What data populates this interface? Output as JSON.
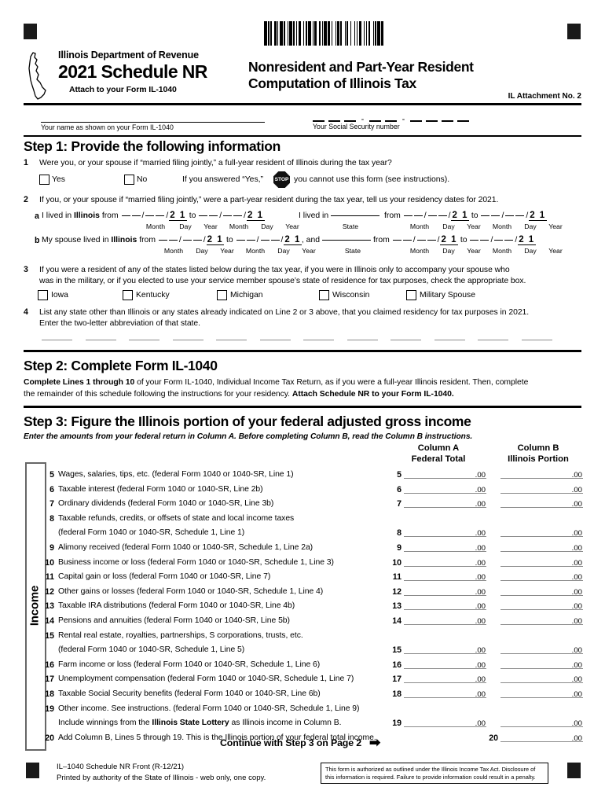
{
  "header": {
    "department": "Illinois Department of Revenue",
    "schedule_title": "2021 Schedule NR",
    "attach_note": "Attach to your Form IL-1040",
    "form_title_line1": "Nonresident and Part-Year Resident",
    "form_title_line2": "Computation of Illinois Tax",
    "attachment_no": "IL Attachment No. 2"
  },
  "identity": {
    "name_label": "Your name as shown on your Form IL-1040",
    "ssn_label": "Your Social Security number"
  },
  "step1": {
    "heading": "Step 1: Provide the following information",
    "q1": {
      "num": "1",
      "text": "Were you, or your spouse if “married filing jointly,” a full-year resident of Illinois during the tax year?",
      "yes_label": "Yes",
      "no_label": "No",
      "warning_prefix": "If you answered “Yes,”",
      "stop_icon_text": "STOP",
      "warning_suffix": "you cannot use this form (see instructions)."
    },
    "q2": {
      "num": "2",
      "text": "If you, or your spouse if “married filing jointly,” were a part-year resident during the tax year, tell us your residency dates for 2021.",
      "line_a": {
        "letter": "a",
        "prefix": "I lived in ",
        "state_bold": "Illinois",
        "from_word": "from",
        "to_word": "to",
        "year_preprint": "2 1",
        "second_prefix": "I lived in",
        "state_label": "State",
        "month_label": "Month",
        "day_label": "Day",
        "year_label": "Year"
      },
      "line_b": {
        "letter": "b",
        "prefix": "My spouse lived in ",
        "state_bold": "Illinois",
        "from_word": "from",
        "to_word": "to",
        "and_word": ", and",
        "year_preprint": "2 1",
        "state_label": "State",
        "month_label": "Month",
        "day_label": "Day",
        "year_label": "Year"
      }
    },
    "q3": {
      "num": "3",
      "text_line1": "If you were a resident of any of the states listed below during the tax year, if you were in Illinois only to accompany your spouse who",
      "text_line2": "was in the military, or if you elected to use your service member spouse’s state of residence for tax purposes, check the appropriate box.",
      "options": [
        "Iowa",
        "Kentucky",
        "Michigan",
        "Wisconsin",
        "Military Spouse"
      ]
    },
    "q4": {
      "num": "4",
      "text_line1": "List any state other than Illinois or any states already indicated on Line 2 or 3 above, that you claimed residency for tax purposes in 2021.",
      "text_line2": "Enter the two-letter abbreviation of that state.",
      "blank_count": 12
    }
  },
  "step2": {
    "heading": "Step 2: Complete Form IL-1040",
    "body_bold_1": "Complete Lines 1 through 10",
    "body_1": " of your Form IL-1040, Individual Income Tax Return, as if you were a full-year Illinois resident. Then, complete",
    "body_2": "the remainder of this schedule following the instructions for your residency. ",
    "body_bold_2": "Attach Schedule NR to your Form IL-1040."
  },
  "step3": {
    "heading": "Step 3: Figure the Illinois portion of your federal adjusted gross income",
    "subheading": "Enter the amounts from your federal return in Column A. Before completing Column B, read the Column B instructions.",
    "column_a_l1": "Column A",
    "column_a_l2": "Federal Total",
    "column_b_l1": "Column B",
    "column_b_l2": "Illinois Portion",
    "section_label": "Income",
    "cents_suffix": ".00",
    "lines": [
      {
        "num": "5",
        "text": "Wages, salaries, tips, etc. (federal Form 1040 or 1040-SR, Line 1)",
        "amt_num": "5",
        "col_a": true,
        "col_b": true
      },
      {
        "num": "6",
        "text": "Taxable interest (federal Form 1040 or 1040-SR, Line 2b)",
        "amt_num": "6",
        "col_a": true,
        "col_b": true
      },
      {
        "num": "7",
        "text": "Ordinary dividends (federal Form 1040 or 1040-SR, Line 3b)",
        "amt_num": "7",
        "col_a": true,
        "col_b": true
      },
      {
        "num": "8",
        "text": "Taxable refunds, credits, or offsets of state and local income taxes",
        "amt_num": "",
        "col_a": false,
        "col_b": false
      },
      {
        "num": "",
        "text": "(federal Form 1040 or 1040-SR, Schedule 1, Line 1)",
        "amt_num": "8",
        "col_a": true,
        "col_b": true
      },
      {
        "num": "9",
        "text": "Alimony received (federal Form 1040 or 1040-SR, Schedule 1, Line 2a)",
        "amt_num": "9",
        "col_a": true,
        "col_b": true
      },
      {
        "num": "10",
        "text": "Business income or loss (federal Form 1040 or 1040-SR, Schedule 1, Line 3)",
        "amt_num": "10",
        "col_a": true,
        "col_b": true
      },
      {
        "num": "11",
        "text": "Capital gain or loss (federal Form 1040 or 1040-SR, Line 7)",
        "amt_num": "11",
        "col_a": true,
        "col_b": true
      },
      {
        "num": "12",
        "text": "Other gains or losses (federal Form 1040 or 1040-SR, Schedule 1, Line 4)",
        "amt_num": "12",
        "col_a": true,
        "col_b": true
      },
      {
        "num": "13",
        "text": "Taxable IRA distributions (federal Form 1040 or 1040-SR, Line 4b)",
        "amt_num": "13",
        "col_a": true,
        "col_b": true
      },
      {
        "num": "14",
        "text": " Pensions and annuities (federal Form 1040 or 1040-SR, Line 5b)",
        "amt_num": "14",
        "col_a": true,
        "col_b": true
      },
      {
        "num": "15",
        "text": "Rental real estate, royalties, partnerships, S corporations, trusts, etc.",
        "amt_num": "",
        "col_a": false,
        "col_b": false
      },
      {
        "num": "",
        "text": "(federal Form 1040 or 1040-SR, Schedule 1, Line 5)",
        "amt_num": "15",
        "col_a": true,
        "col_b": true
      },
      {
        "num": "16",
        "text": "Farm income or loss (federal Form 1040 or 1040-SR, Schedule 1, Line 6)",
        "amt_num": "16",
        "col_a": true,
        "col_b": true
      },
      {
        "num": "17",
        "text": "Unemployment compensation (federal Form 1040 or 1040-SR, Schedule 1, Line 7)",
        "amt_num": "17",
        "col_a": true,
        "col_b": true
      },
      {
        "num": "18",
        "text": "Taxable Social Security benefits (federal Form 1040 or 1040-SR, Line 6b)",
        "amt_num": "18",
        "col_a": true,
        "col_b": true
      },
      {
        "num": "19",
        "text": "Other income. See instructions. (federal Form 1040 or 1040-SR, Schedule 1, Line 9)",
        "amt_num": "",
        "col_a": false,
        "col_b": false
      },
      {
        "num": "",
        "text": "Include winnings from the <b>Illinois State Lottery</b> as Illinois income in Column B.",
        "amt_num": "19",
        "col_a": true,
        "col_b": true
      },
      {
        "num": "20",
        "text": "Add Column B, Lines 5 through 19. This is the Illinois portion of your federal total income.",
        "amt_num": "20",
        "col_a": false,
        "col_b": true
      }
    ],
    "continue_text": "Continue with Step 3 on Page 2",
    "continue_arrow": "➡"
  },
  "footer": {
    "form_id": "IL–1040 Schedule NR Front (R-12/21)",
    "printed_by": "Printed by authority of the State of Illinois - web only, one copy.",
    "notice_line1": "This form is authorized as outlined under the Illinois Income Tax Act. Disclosure of",
    "notice_line2": "this information is required.  Failure to provide information could result in a penalty."
  },
  "barcode": {
    "widths": [
      3,
      1,
      2,
      1,
      1,
      3,
      2,
      1,
      1,
      2,
      3,
      1,
      2,
      2,
      1,
      1,
      3,
      1,
      2,
      1,
      1,
      2,
      2,
      3,
      1,
      1,
      2,
      1,
      3,
      2,
      1,
      1,
      2,
      3,
      1,
      2,
      1,
      1,
      3,
      1,
      2,
      2,
      1,
      3,
      1,
      1,
      2,
      1,
      2,
      3,
      1,
      1,
      2,
      2,
      1,
      3,
      1,
      2,
      1,
      1,
      3,
      2,
      1,
      2,
      1,
      1,
      2,
      3,
      1,
      1,
      2,
      1,
      3,
      1,
      2,
      2
    ]
  }
}
